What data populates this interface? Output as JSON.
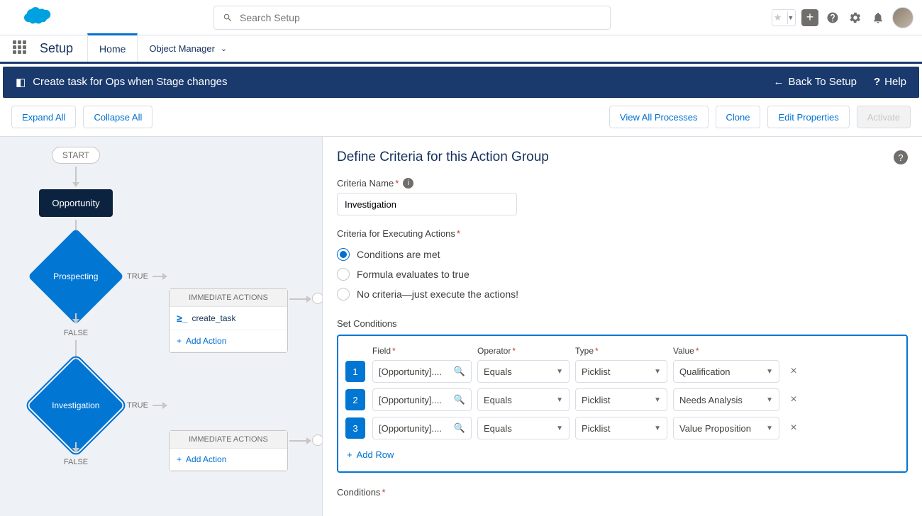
{
  "header": {
    "search_placeholder": "Search Setup"
  },
  "nav": {
    "app_title": "Setup",
    "tab_home": "Home",
    "tab_object_manager": "Object Manager"
  },
  "bluebar": {
    "process_name": "Create task for Ops when Stage changes",
    "back_label": "Back To Setup",
    "help_label": "Help"
  },
  "actionbar": {
    "expand": "Expand All",
    "collapse": "Collapse All",
    "view_all": "View All Processes",
    "clone": "Clone",
    "edit_props": "Edit Properties",
    "activate": "Activate"
  },
  "canvas": {
    "start": "START",
    "object": "Opportunity",
    "criteria1": "Prospecting",
    "criteria2": "Investigation",
    "true_label": "TRUE",
    "false_label": "FALSE",
    "immediate_hdr": "IMMEDIATE ACTIONS",
    "action1": "create_task",
    "add_action": "Add Action"
  },
  "panel": {
    "title": "Define Criteria for this Action Group",
    "criteria_name_label": "Criteria Name",
    "criteria_name_value": "Investigation",
    "exec_label": "Criteria for Executing Actions",
    "radio1": "Conditions are met",
    "radio2": "Formula evaluates to true",
    "radio3": "No criteria—just execute the actions!",
    "set_conditions": "Set Conditions",
    "col_field": "Field",
    "col_operator": "Operator",
    "col_type": "Type",
    "col_value": "Value",
    "rows": [
      {
        "num": "1",
        "field": "[Opportunity]....",
        "operator": "Equals",
        "type": "Picklist",
        "value": "Qualification"
      },
      {
        "num": "2",
        "field": "[Opportunity]....",
        "operator": "Equals",
        "type": "Picklist",
        "value": "Needs Analysis"
      },
      {
        "num": "3",
        "field": "[Opportunity]....",
        "operator": "Equals",
        "type": "Picklist",
        "value": "Value Proposition"
      }
    ],
    "add_row": "Add Row",
    "conditions_label": "Conditions"
  }
}
